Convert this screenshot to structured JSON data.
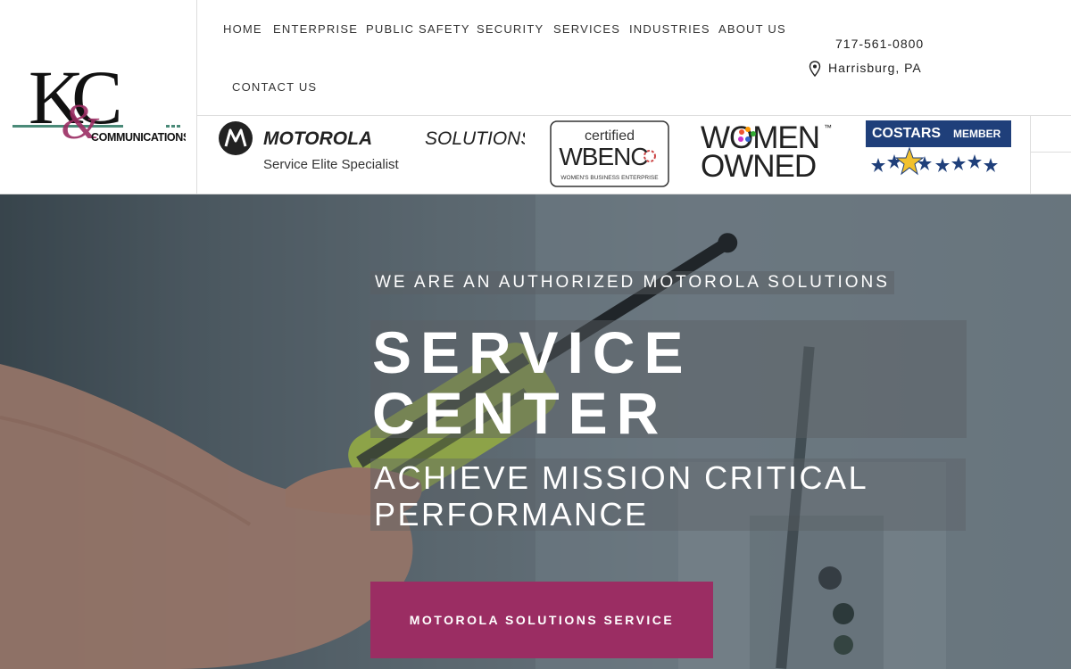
{
  "brand": {
    "logo_alt": "K&C Communications",
    "logo_letters": "KC",
    "logo_ampersand": "&",
    "logo_subtitle": "COMMUNICATIONS",
    "colors": {
      "primary": "#9b2d63",
      "teal": "#4a8a78",
      "dark": "#111111"
    }
  },
  "nav": {
    "items": [
      {
        "label": "HOME"
      },
      {
        "label": "ENTERPRISE"
      },
      {
        "label": "PUBLIC SAFETY"
      },
      {
        "label": "SECURITY"
      },
      {
        "label": "SERVICES"
      },
      {
        "label": "INDUSTRIES"
      },
      {
        "label": "ABOUT US"
      },
      {
        "label": "CONTACT US"
      }
    ]
  },
  "contact": {
    "phone": "717-561-0800",
    "location": "Harrisburg, PA",
    "location_icon": "map-pin-icon"
  },
  "badges": {
    "motorola": {
      "name": "MOTOROLA",
      "solutions": "SOLUTIONS",
      "tagline": "Service Elite Specialist"
    },
    "wbenc": {
      "certified": "certified",
      "name": "WBENC",
      "caption": "WOMEN'S BUSINESS ENTERPRISE"
    },
    "women_owned": {
      "line1": "WOMEN",
      "line2": "OWNED",
      "tm": "™"
    },
    "costars": {
      "name": "COSTARS",
      "member": "MEMBER"
    }
  },
  "hero": {
    "kicker": "WE ARE AN AUTHORIZED MOTOROLA SOLUTIONS",
    "title_line1": "SERVICE",
    "title_line2": "CENTER",
    "subtitle_line1": "ACHIEVE MISSION CRITICAL",
    "subtitle_line2": "PERFORMANCE",
    "cta_label": "MOTOROLA SOLUTIONS SERVICE"
  }
}
